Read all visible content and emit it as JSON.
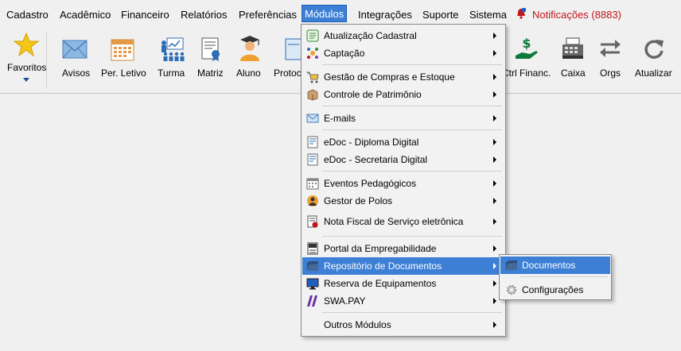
{
  "menubar": {
    "items": [
      "Cadastro",
      "Acadêmico",
      "Financeiro",
      "Relatórios",
      "Preferências",
      "Módulos",
      "Integrações",
      "Suporte",
      "Sistema"
    ],
    "notifications": "Notificações (8883)"
  },
  "toolbar": {
    "items": [
      "Favoritos",
      "Avisos",
      "Per. Letivo",
      "Turma",
      "Matriz",
      "Aluno",
      "Protoc",
      "Ctrl Financ.",
      "Caixa",
      "Orgs",
      "Atualizar"
    ]
  },
  "modules_menu": {
    "items": [
      {
        "label": "Atualização Cadastral",
        "icon": "list-icon"
      },
      {
        "label": "Captação",
        "icon": "network-icon"
      },
      {
        "label": "Gestão de Compras e Estoque",
        "icon": "cart-icon"
      },
      {
        "label": "Controle de Patrimônio",
        "icon": "box-icon"
      },
      {
        "label": "E-mails",
        "icon": "envelope-icon"
      },
      {
        "label": "eDoc - Diploma Digital",
        "icon": "document-icon"
      },
      {
        "label": "eDoc - Secretaria Digital",
        "icon": "document-icon"
      },
      {
        "label": "Eventos Pedagógicos",
        "icon": "calendar-icon"
      },
      {
        "label": "Gestor de Polos",
        "icon": "globe-person-icon"
      },
      {
        "label": "Nota Fiscal de Serviço eletrônica",
        "icon": "invoice-icon"
      },
      {
        "label": "Portal da Empregabilidade",
        "icon": "cv-icon"
      },
      {
        "label": "Repositório de Documentos",
        "icon": "folder-icon"
      },
      {
        "label": "Reserva de Equipamentos",
        "icon": "monitor-icon"
      },
      {
        "label": "SWA.PAY",
        "icon": "slash-icon"
      },
      {
        "label": "Outros Módulos",
        "icon": ""
      }
    ]
  },
  "repository_submenu": {
    "items": [
      {
        "label": "Documentos",
        "icon": "folder-icon"
      },
      {
        "label": "Configurações",
        "icon": "gear-icon"
      }
    ]
  },
  "colors": {
    "highlight": "#3c7fd5",
    "notification": "#c0161b",
    "background": "#f0f0f0"
  }
}
